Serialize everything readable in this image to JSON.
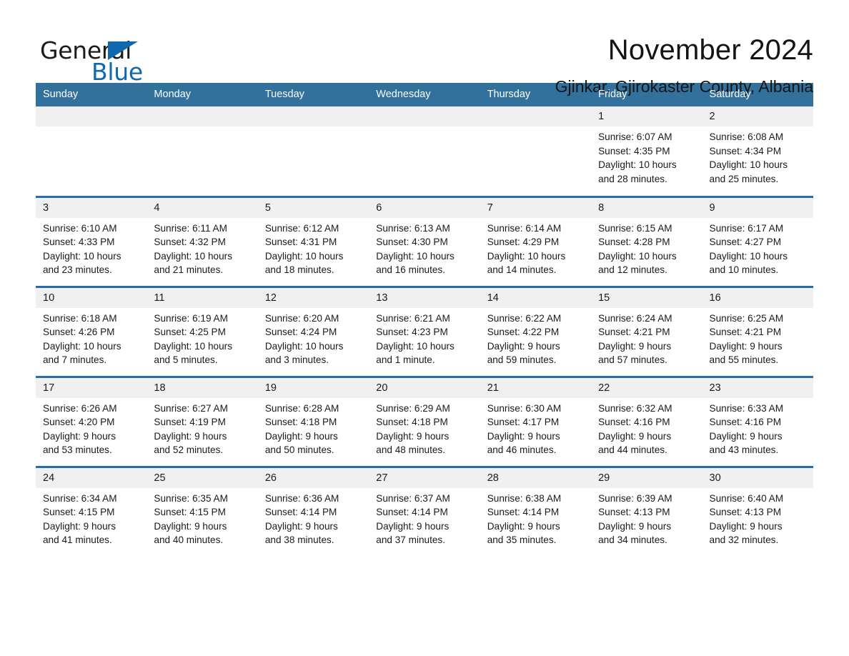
{
  "brand": {
    "name_part1": "General",
    "name_part2": "Blue",
    "accent_color": "#1069b0"
  },
  "header": {
    "month_title": "November 2024",
    "location": "Gjinkar, Gjirokaster County, Albania"
  },
  "calendar": {
    "header_bg": "#31719c",
    "row_divider_color": "#2a6ca6",
    "daynum_bg": "#f0f0f0",
    "weekdays": [
      "Sunday",
      "Monday",
      "Tuesday",
      "Wednesday",
      "Thursday",
      "Friday",
      "Saturday"
    ],
    "weeks": [
      [
        {
          "day": "",
          "sunrise": "",
          "sunset": "",
          "daylight1": "",
          "daylight2": ""
        },
        {
          "day": "",
          "sunrise": "",
          "sunset": "",
          "daylight1": "",
          "daylight2": ""
        },
        {
          "day": "",
          "sunrise": "",
          "sunset": "",
          "daylight1": "",
          "daylight2": ""
        },
        {
          "day": "",
          "sunrise": "",
          "sunset": "",
          "daylight1": "",
          "daylight2": ""
        },
        {
          "day": "",
          "sunrise": "",
          "sunset": "",
          "daylight1": "",
          "daylight2": ""
        },
        {
          "day": "1",
          "sunrise": "Sunrise: 6:07 AM",
          "sunset": "Sunset: 4:35 PM",
          "daylight1": "Daylight: 10 hours",
          "daylight2": "and 28 minutes."
        },
        {
          "day": "2",
          "sunrise": "Sunrise: 6:08 AM",
          "sunset": "Sunset: 4:34 PM",
          "daylight1": "Daylight: 10 hours",
          "daylight2": "and 25 minutes."
        }
      ],
      [
        {
          "day": "3",
          "sunrise": "Sunrise: 6:10 AM",
          "sunset": "Sunset: 4:33 PM",
          "daylight1": "Daylight: 10 hours",
          "daylight2": "and 23 minutes."
        },
        {
          "day": "4",
          "sunrise": "Sunrise: 6:11 AM",
          "sunset": "Sunset: 4:32 PM",
          "daylight1": "Daylight: 10 hours",
          "daylight2": "and 21 minutes."
        },
        {
          "day": "5",
          "sunrise": "Sunrise: 6:12 AM",
          "sunset": "Sunset: 4:31 PM",
          "daylight1": "Daylight: 10 hours",
          "daylight2": "and 18 minutes."
        },
        {
          "day": "6",
          "sunrise": "Sunrise: 6:13 AM",
          "sunset": "Sunset: 4:30 PM",
          "daylight1": "Daylight: 10 hours",
          "daylight2": "and 16 minutes."
        },
        {
          "day": "7",
          "sunrise": "Sunrise: 6:14 AM",
          "sunset": "Sunset: 4:29 PM",
          "daylight1": "Daylight: 10 hours",
          "daylight2": "and 14 minutes."
        },
        {
          "day": "8",
          "sunrise": "Sunrise: 6:15 AM",
          "sunset": "Sunset: 4:28 PM",
          "daylight1": "Daylight: 10 hours",
          "daylight2": "and 12 minutes."
        },
        {
          "day": "9",
          "sunrise": "Sunrise: 6:17 AM",
          "sunset": "Sunset: 4:27 PM",
          "daylight1": "Daylight: 10 hours",
          "daylight2": "and 10 minutes."
        }
      ],
      [
        {
          "day": "10",
          "sunrise": "Sunrise: 6:18 AM",
          "sunset": "Sunset: 4:26 PM",
          "daylight1": "Daylight: 10 hours",
          "daylight2": "and 7 minutes."
        },
        {
          "day": "11",
          "sunrise": "Sunrise: 6:19 AM",
          "sunset": "Sunset: 4:25 PM",
          "daylight1": "Daylight: 10 hours",
          "daylight2": "and 5 minutes."
        },
        {
          "day": "12",
          "sunrise": "Sunrise: 6:20 AM",
          "sunset": "Sunset: 4:24 PM",
          "daylight1": "Daylight: 10 hours",
          "daylight2": "and 3 minutes."
        },
        {
          "day": "13",
          "sunrise": "Sunrise: 6:21 AM",
          "sunset": "Sunset: 4:23 PM",
          "daylight1": "Daylight: 10 hours",
          "daylight2": "and 1 minute."
        },
        {
          "day": "14",
          "sunrise": "Sunrise: 6:22 AM",
          "sunset": "Sunset: 4:22 PM",
          "daylight1": "Daylight: 9 hours",
          "daylight2": "and 59 minutes."
        },
        {
          "day": "15",
          "sunrise": "Sunrise: 6:24 AM",
          "sunset": "Sunset: 4:21 PM",
          "daylight1": "Daylight: 9 hours",
          "daylight2": "and 57 minutes."
        },
        {
          "day": "16",
          "sunrise": "Sunrise: 6:25 AM",
          "sunset": "Sunset: 4:21 PM",
          "daylight1": "Daylight: 9 hours",
          "daylight2": "and 55 minutes."
        }
      ],
      [
        {
          "day": "17",
          "sunrise": "Sunrise: 6:26 AM",
          "sunset": "Sunset: 4:20 PM",
          "daylight1": "Daylight: 9 hours",
          "daylight2": "and 53 minutes."
        },
        {
          "day": "18",
          "sunrise": "Sunrise: 6:27 AM",
          "sunset": "Sunset: 4:19 PM",
          "daylight1": "Daylight: 9 hours",
          "daylight2": "and 52 minutes."
        },
        {
          "day": "19",
          "sunrise": "Sunrise: 6:28 AM",
          "sunset": "Sunset: 4:18 PM",
          "daylight1": "Daylight: 9 hours",
          "daylight2": "and 50 minutes."
        },
        {
          "day": "20",
          "sunrise": "Sunrise: 6:29 AM",
          "sunset": "Sunset: 4:18 PM",
          "daylight1": "Daylight: 9 hours",
          "daylight2": "and 48 minutes."
        },
        {
          "day": "21",
          "sunrise": "Sunrise: 6:30 AM",
          "sunset": "Sunset: 4:17 PM",
          "daylight1": "Daylight: 9 hours",
          "daylight2": "and 46 minutes."
        },
        {
          "day": "22",
          "sunrise": "Sunrise: 6:32 AM",
          "sunset": "Sunset: 4:16 PM",
          "daylight1": "Daylight: 9 hours",
          "daylight2": "and 44 minutes."
        },
        {
          "day": "23",
          "sunrise": "Sunrise: 6:33 AM",
          "sunset": "Sunset: 4:16 PM",
          "daylight1": "Daylight: 9 hours",
          "daylight2": "and 43 minutes."
        }
      ],
      [
        {
          "day": "24",
          "sunrise": "Sunrise: 6:34 AM",
          "sunset": "Sunset: 4:15 PM",
          "daylight1": "Daylight: 9 hours",
          "daylight2": "and 41 minutes."
        },
        {
          "day": "25",
          "sunrise": "Sunrise: 6:35 AM",
          "sunset": "Sunset: 4:15 PM",
          "daylight1": "Daylight: 9 hours",
          "daylight2": "and 40 minutes."
        },
        {
          "day": "26",
          "sunrise": "Sunrise: 6:36 AM",
          "sunset": "Sunset: 4:14 PM",
          "daylight1": "Daylight: 9 hours",
          "daylight2": "and 38 minutes."
        },
        {
          "day": "27",
          "sunrise": "Sunrise: 6:37 AM",
          "sunset": "Sunset: 4:14 PM",
          "daylight1": "Daylight: 9 hours",
          "daylight2": "and 37 minutes."
        },
        {
          "day": "28",
          "sunrise": "Sunrise: 6:38 AM",
          "sunset": "Sunset: 4:14 PM",
          "daylight1": "Daylight: 9 hours",
          "daylight2": "and 35 minutes."
        },
        {
          "day": "29",
          "sunrise": "Sunrise: 6:39 AM",
          "sunset": "Sunset: 4:13 PM",
          "daylight1": "Daylight: 9 hours",
          "daylight2": "and 34 minutes."
        },
        {
          "day": "30",
          "sunrise": "Sunrise: 6:40 AM",
          "sunset": "Sunset: 4:13 PM",
          "daylight1": "Daylight: 9 hours",
          "daylight2": "and 32 minutes."
        }
      ]
    ]
  }
}
